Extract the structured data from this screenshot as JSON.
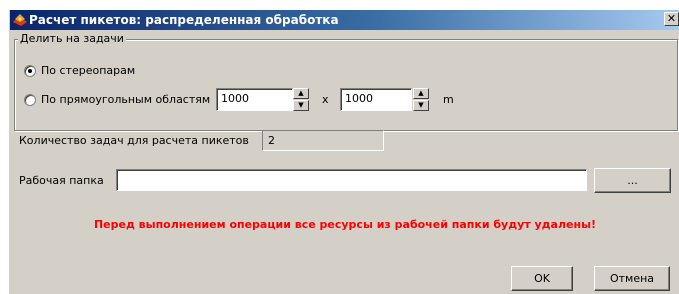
{
  "window": {
    "title": "Расчет пикетов: распределенная обработка",
    "close_label": "✕"
  },
  "split": {
    "legend": "Делить на задачи",
    "option_stereopairs": "По стереопарам",
    "option_rectangles": "По прямоугольным областям",
    "selected": "По стереопарам",
    "width_value": "1000",
    "height_value": "1000",
    "times_label": "x",
    "unit_label": "m"
  },
  "tasks": {
    "label": "Количество задач для расчета пикетов",
    "value": "2"
  },
  "folder": {
    "label": "Рабочая папка",
    "value": "",
    "browse_label": "..."
  },
  "warning": "Перед выполнением операции все ресурсы из рабочей папки будут удалены!",
  "buttons": {
    "ok": "OK",
    "cancel": "Отмена"
  },
  "colors": {
    "warning": "#ff0000",
    "title_start": "#0a246a",
    "title_end": "#a6caf0",
    "dialog_bg": "#d4d0c8"
  },
  "icons": {
    "app": "app-icon",
    "spin_up": "arrow-up-icon",
    "spin_down": "arrow-down-icon"
  }
}
